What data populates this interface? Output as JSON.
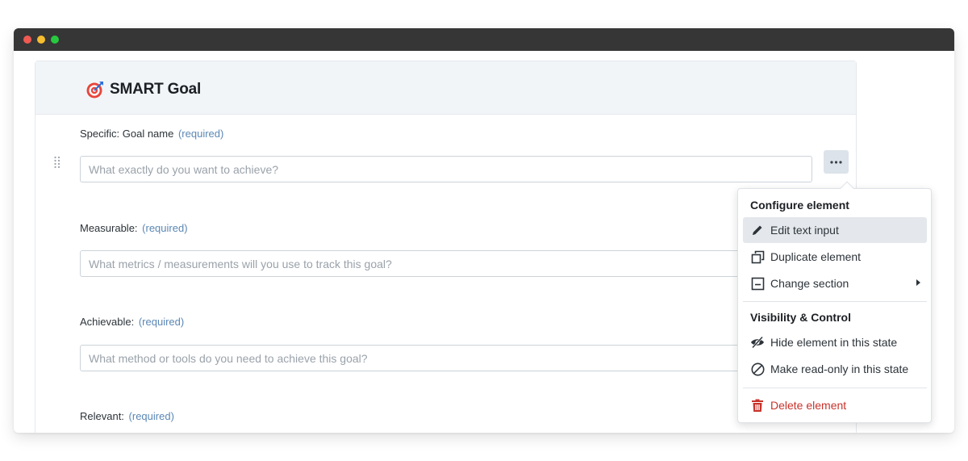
{
  "form": {
    "title": "SMART Goal",
    "required_marker": "(required)",
    "fields": [
      {
        "label": "Specific: Goal name",
        "placeholder": "What exactly do you want to achieve?",
        "value": ""
      },
      {
        "label": "Measurable:",
        "placeholder": "What metrics / measurements will you use to track this goal?",
        "value": ""
      },
      {
        "label": "Achievable:",
        "placeholder": "What method or tools do you need to achieve this goal?",
        "value": ""
      },
      {
        "label": "Relevant:",
        "placeholder": "",
        "value": ""
      }
    ]
  },
  "menu": {
    "configure_heading": "Configure element",
    "edit_text_input": "Edit text input",
    "duplicate_element": "Duplicate element",
    "change_section": "Change section",
    "visibility_heading": "Visibility & Control",
    "hide_element": "Hide element in this state",
    "make_read_only": "Make read-only in this state",
    "delete_element": "Delete element"
  },
  "icons": {
    "goal": "target-icon",
    "drag": "drag-handle-icon",
    "more": "more-dots-icon",
    "edit": "pencil-icon",
    "duplicate": "duplicate-icon",
    "section": "section-icon",
    "hide": "eye-slash-icon",
    "read_only": "block-icon",
    "delete": "trash-icon"
  },
  "colors": {
    "accent_required": "#5b87b5",
    "danger": "#c7332b",
    "header_bg": "#f2f5f8"
  }
}
